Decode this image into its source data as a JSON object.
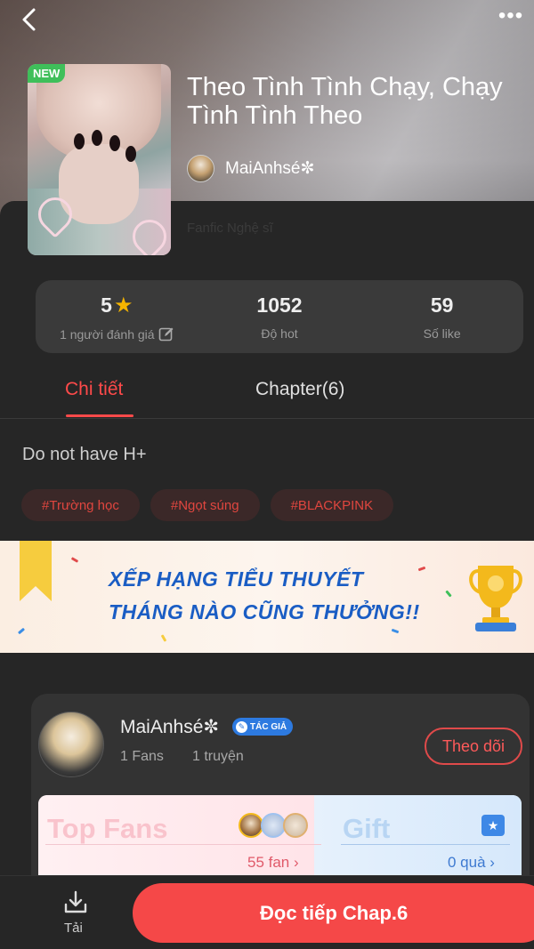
{
  "header": {
    "back_icon": "chevron-left-icon",
    "more_icon": "more-horizontal-icon",
    "more_label": "•••"
  },
  "story": {
    "badge": "NEW",
    "title": "Theo Tình Tình Chạy, Chạy Tình Tình Theo",
    "author": "MaiAnhsé✼",
    "genre": "Fanfic Nghệ sĩ"
  },
  "stats": {
    "rating_value": "5",
    "rating_label": "1 người đánh giá",
    "hot_value": "1052",
    "hot_label": "Độ hot",
    "likes_value": "59",
    "likes_label": "Số like"
  },
  "tabs": {
    "details": "Chi tiết",
    "chapters": "Chapter(6)"
  },
  "description": "Do not have H+",
  "tags": [
    "#Trường học",
    "#Ngọt súng",
    "#BLACKPINK"
  ],
  "banner": {
    "line1": "XẾP HẠNG TIỂU THUYẾT",
    "line2": "THÁNG NÀO CŨNG THƯỞNG!!"
  },
  "author_card": {
    "name": "MaiAnhsé✼",
    "badge": "TÁC GIẢ",
    "fans": "1 Fans",
    "works": "1 truyện",
    "follow": "Theo dõi",
    "top_fans_title": "Top Fans",
    "top_fans_count": "55 fan",
    "gift_title": "Gift",
    "gift_count": "0 quà"
  },
  "bottom_bar": {
    "download_label": "Tải",
    "read_button": "Đọc tiếp Chap.6"
  },
  "colors": {
    "accent_red": "#f54848",
    "star_yellow": "#f5b400",
    "banner_blue": "#1a5dc4",
    "new_green": "#3fbf5a"
  }
}
